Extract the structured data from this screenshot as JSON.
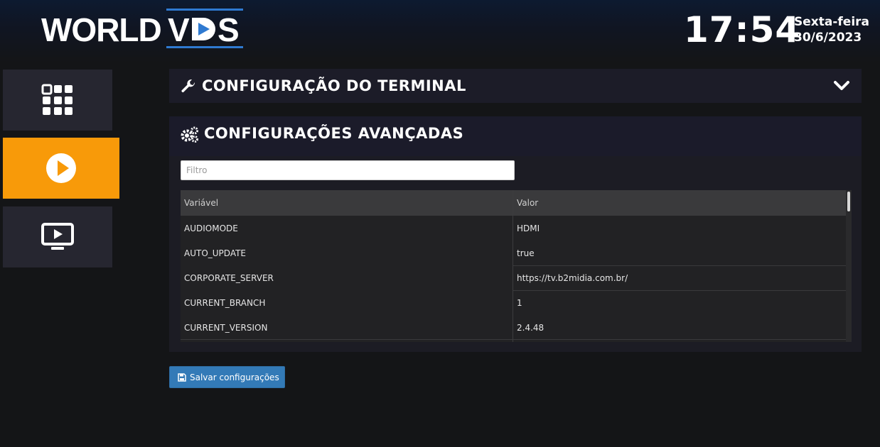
{
  "header": {
    "logo": {
      "word1": "WORLD",
      "v": "V",
      "d_icon": "play-d-icon",
      "s": "S",
      "accent_color": "#2f7ad1"
    },
    "time": "17:54",
    "weekday": "Sexta-feira",
    "date": "30/6/2023"
  },
  "sidebar": {
    "items": [
      {
        "icon": "apps-grid-icon",
        "active": false
      },
      {
        "icon": "play-circle-icon",
        "active": true
      },
      {
        "icon": "monitor-play-icon",
        "active": false
      }
    ],
    "active_color": "#f89a09"
  },
  "terminal_panel": {
    "title": "CONFIGURAÇÃO DO TERMINAL",
    "icon": "wrench-icon",
    "toggle_icon": "chevron-down-icon"
  },
  "advanced_panel": {
    "title": "CONFIGURAÇÕES AVANÇADAS",
    "icon": "gears-icon",
    "filter": {
      "placeholder": "Filtro",
      "value": ""
    },
    "table": {
      "headers": [
        "Variável",
        "Valor"
      ],
      "rows": [
        [
          "AUDIOMODE",
          "HDMI"
        ],
        [
          "AUTO_UPDATE",
          "true"
        ],
        [
          "CORPORATE_SERVER",
          "https://tv.b2midia.com.br/"
        ],
        [
          "CURRENT_BRANCH",
          "1"
        ],
        [
          "CURRENT_VERSION",
          "2.4.48"
        ]
      ]
    }
  },
  "save_button": {
    "label": "Salvar configurações",
    "icon": "floppy-disk-icon",
    "color": "#337ab7"
  }
}
